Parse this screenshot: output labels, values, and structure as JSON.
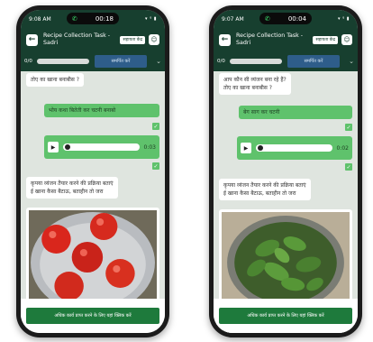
{
  "screens": [
    {
      "status_time": "9:08 AM",
      "call_timer": "00:18",
      "status_icons": "▾ ᵍ ▮",
      "header_title_line1": "Recipe Collection Task -",
      "header_title_line2": "Sadri",
      "help_label": "सहायता केंद्र",
      "progress_count": "0/0",
      "submit_label": "समर्पित करें",
      "msg_in_1": "तोए का खाना बनाबीस ?",
      "msg_out_1": "भोय कथा बितेती कर चटनी बनाबो",
      "audio_duration": "0:03",
      "msg_in_2_line1": "कृपया व्यंजन तैयार करने की प्रक्रिया बताएं",
      "msg_in_2_line2": "ई खाना कैसा बैटाऊ, बताहीन तो जरा",
      "cta_label": "अधिक कार्य प्राप्त करने के लिए यहां क्लिक करें"
    },
    {
      "status_time": "9:07 AM",
      "call_timer": "00:04",
      "status_icons": "▾ ᵍ ▮",
      "header_title_line1": "Recipe Collection Task -",
      "header_title_line2": "Sadri",
      "help_label": "सहायता केंद्र",
      "progress_count": "0/0",
      "submit_label": "समर्पित करें",
      "msg_in_0_line1": "आप कौन सी व्यंजन बना रहे हैं?",
      "msg_in_0_line2": "तोए का खाना बनाबीस ?",
      "msg_out_1": "बेग साग कर चटनी",
      "audio_duration": "0:02",
      "msg_in_2_line1": "कृपया व्यंजन तैयार करने की प्रक्रिया बताएं",
      "msg_in_2_line2": "ई खाना कैसा बैटाऊ, बताहीन तो जरा",
      "cta_label": "अधिक कार्य प्राप्त करने के लिए यहां क्लिक करें"
    }
  ],
  "icons": {
    "back": "←",
    "avatar": "☺",
    "call": "✆",
    "chevron": "⌄",
    "check": "✓",
    "play": "▶"
  },
  "colors": {
    "header": "#173f2f",
    "bubble_out": "#5fc26c",
    "cta": "#1e7a3c",
    "submit": "#2e5d8a"
  }
}
